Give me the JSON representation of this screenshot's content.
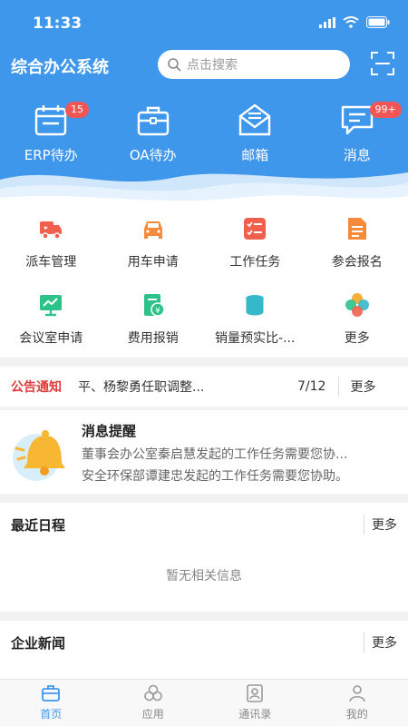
{
  "status": {
    "time": "11:33"
  },
  "header": {
    "app_title": "综合办公系统",
    "search_placeholder": "点击搜索",
    "quick": [
      {
        "label": "ERP待办",
        "badge": "15",
        "icon": "calendar-icon"
      },
      {
        "label": "OA待办",
        "badge": "",
        "icon": "briefcase-icon"
      },
      {
        "label": "邮箱",
        "badge": "",
        "icon": "mail-icon"
      },
      {
        "label": "消息",
        "badge": "99+",
        "icon": "message-icon"
      }
    ]
  },
  "grid": [
    {
      "label": "派车管理",
      "icon": "truck-icon",
      "color": "#f0604d"
    },
    {
      "label": "用车申请",
      "icon": "car-icon",
      "color": "#f58a3a"
    },
    {
      "label": "工作任务",
      "icon": "task-list-icon",
      "color": "#f0604d"
    },
    {
      "label": "参会报名",
      "icon": "document-icon",
      "color": "#f58a3a"
    },
    {
      "label": "会议室申请",
      "icon": "presentation-icon",
      "color": "#2dc28a"
    },
    {
      "label": "费用报销",
      "icon": "reimbursement-icon",
      "color": "#2dc28a"
    },
    {
      "label": "销量预实比-...",
      "icon": "coins-icon",
      "color": "#35b8c9"
    },
    {
      "label": "更多",
      "icon": "more-apps-icon",
      "color": "#f5a623"
    }
  ],
  "notice": {
    "tag": "公告通知",
    "text": "平、杨黎勇任职调整...",
    "count": "7/12",
    "more": "更多"
  },
  "message": {
    "title": "消息提醒",
    "lines": [
      "董事会办公室秦启慧发起的工作任务需要您协...",
      "安全环保部谭建忠发起的工作任务需要您协助。"
    ]
  },
  "schedule": {
    "title": "最近日程",
    "more": "更多",
    "empty": "暂无相关信息"
  },
  "news": {
    "title": "企业新闻",
    "more": "更多"
  },
  "tabs": [
    {
      "label": "首页",
      "icon": "home-briefcase-icon",
      "active": true
    },
    {
      "label": "应用",
      "icon": "apps-icon",
      "active": false
    },
    {
      "label": "通讯录",
      "icon": "contacts-icon",
      "active": false
    },
    {
      "label": "我的",
      "icon": "profile-icon",
      "active": false
    }
  ],
  "colors": {
    "brand": "#3f97ec",
    "alert": "#e03a3a",
    "badge": "#f25555"
  }
}
